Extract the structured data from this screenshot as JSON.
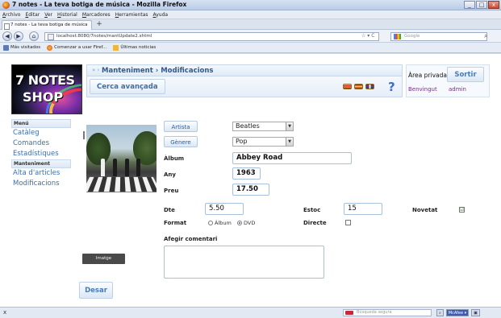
{
  "browser": {
    "title": "7 notes - La teva botiga de música - Mozilla Firefox",
    "menu": [
      "Archivo",
      "Editar",
      "Ver",
      "Historial",
      "Marcadores",
      "Herramientas",
      "Ayuda"
    ],
    "tab_label": "7 notes - La teva botiga de música",
    "new_tab": "+",
    "url": "localhost:8080/7notes/mantUpdate2.xhtml",
    "url_controls": "☆ ▾ C",
    "search_placeholder": "Google",
    "bookmarks": [
      "Más visitados",
      "Comenzar a usar Firef...",
      "Últimas noticias"
    ],
    "window_buttons": [
      "_",
      "□",
      "x"
    ]
  },
  "site": {
    "logo_line1": "7 NOTES",
    "logo_line2": "SHOP",
    "breadcrumb": "Manteniment › Modificacions",
    "advanced_search": "Cerca avançada",
    "help": "?",
    "private_area": "Àrea privada",
    "logout": "Sortir",
    "welcome": "Benvingut",
    "username": "admin"
  },
  "sidebar": {
    "menu_header": "Menú",
    "menu_items": [
      "Catàleg",
      "Comandes",
      "Estadístiques"
    ],
    "maint_header": "Manteniment",
    "maint_items": [
      "Alta d'articles",
      "Modificacions"
    ]
  },
  "form": {
    "artist_button": "Artista",
    "artist_value": "Beatles",
    "genre_button": "Gènere",
    "genre_value": "Pop",
    "album_label": "Àlbum",
    "album_value": "Abbey Road",
    "year_label": "Any",
    "year_value": "1963",
    "price_label": "Preu",
    "price_value": "17.50",
    "discount_label": "Dte",
    "discount_value": "5.50",
    "stock_label": "Estoc",
    "stock_value": "15",
    "new_label": "Novetat",
    "new_checked": "☑",
    "format_label": "Format",
    "format_album": "Àlbum",
    "format_dvd": "DVD",
    "direct_label": "Directe",
    "comment_label": "Afegir comentari",
    "image_button": "Imatge",
    "save_button": "Desar"
  },
  "statusbar": {
    "close": "x",
    "search_placeholder": "Búsqueda segura",
    "icons": [
      "⌕",
      "McAfee ▾",
      "▣"
    ]
  },
  "colors": {
    "link_blue": "#3f6ea6",
    "user_purple": "#7a2d8e"
  }
}
